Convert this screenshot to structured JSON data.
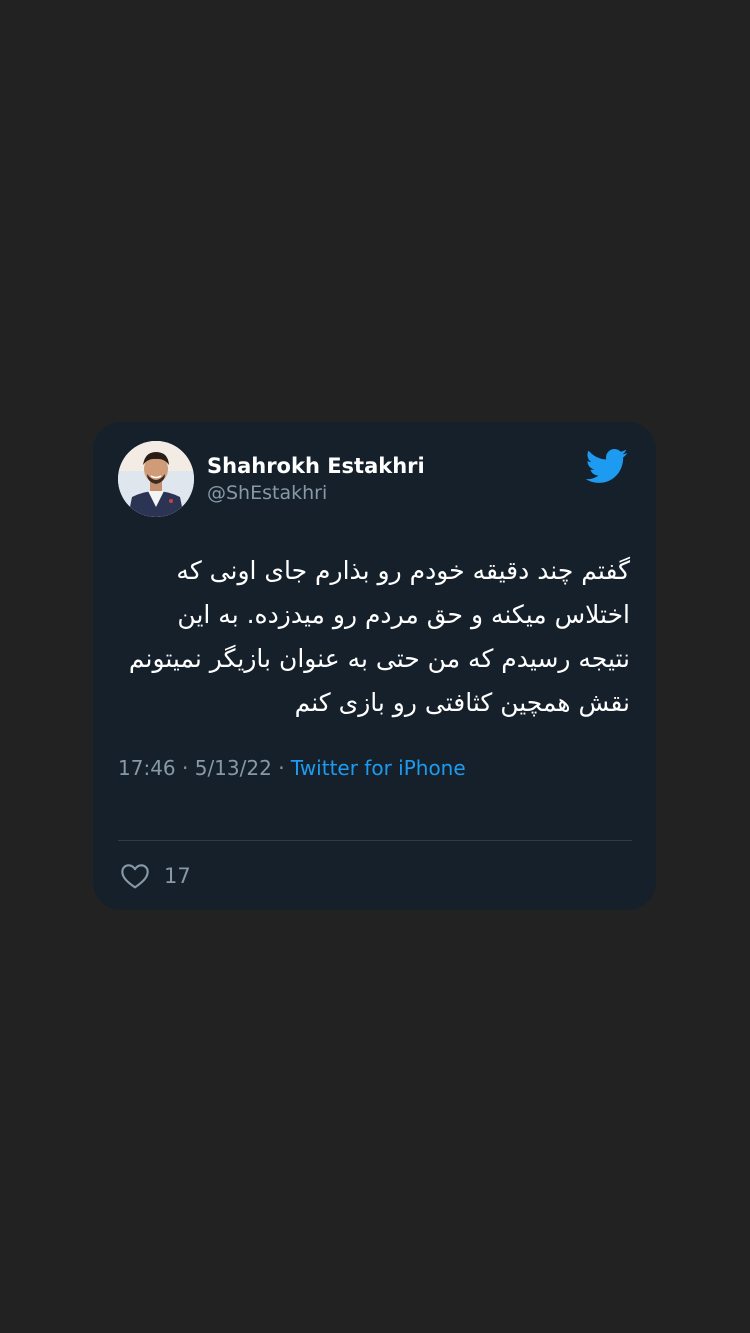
{
  "tweet": {
    "author_name": "Shahrokh Estakhri",
    "author_handle": "@ShEstakhri",
    "text": "گفتم چند دقیقه خودم رو بذارم جای اونی که اختلاس میکنه و حق مردم رو میدزده. به این نتیجه رسیدم که من حتی به عنوان بازیگر نمیتونم نقش همچین کثافتی رو بازی کنم",
    "time": "17:46",
    "date": "5/13/22",
    "separator": "·",
    "source": "Twitter for iPhone",
    "like_count": "17"
  },
  "colors": {
    "background": "#222222",
    "card": "#15202b",
    "accent": "#1d9bf0",
    "muted": "#8899a6"
  },
  "icons": {
    "brand": "twitter-bird-icon",
    "like": "heart-outline-icon"
  }
}
